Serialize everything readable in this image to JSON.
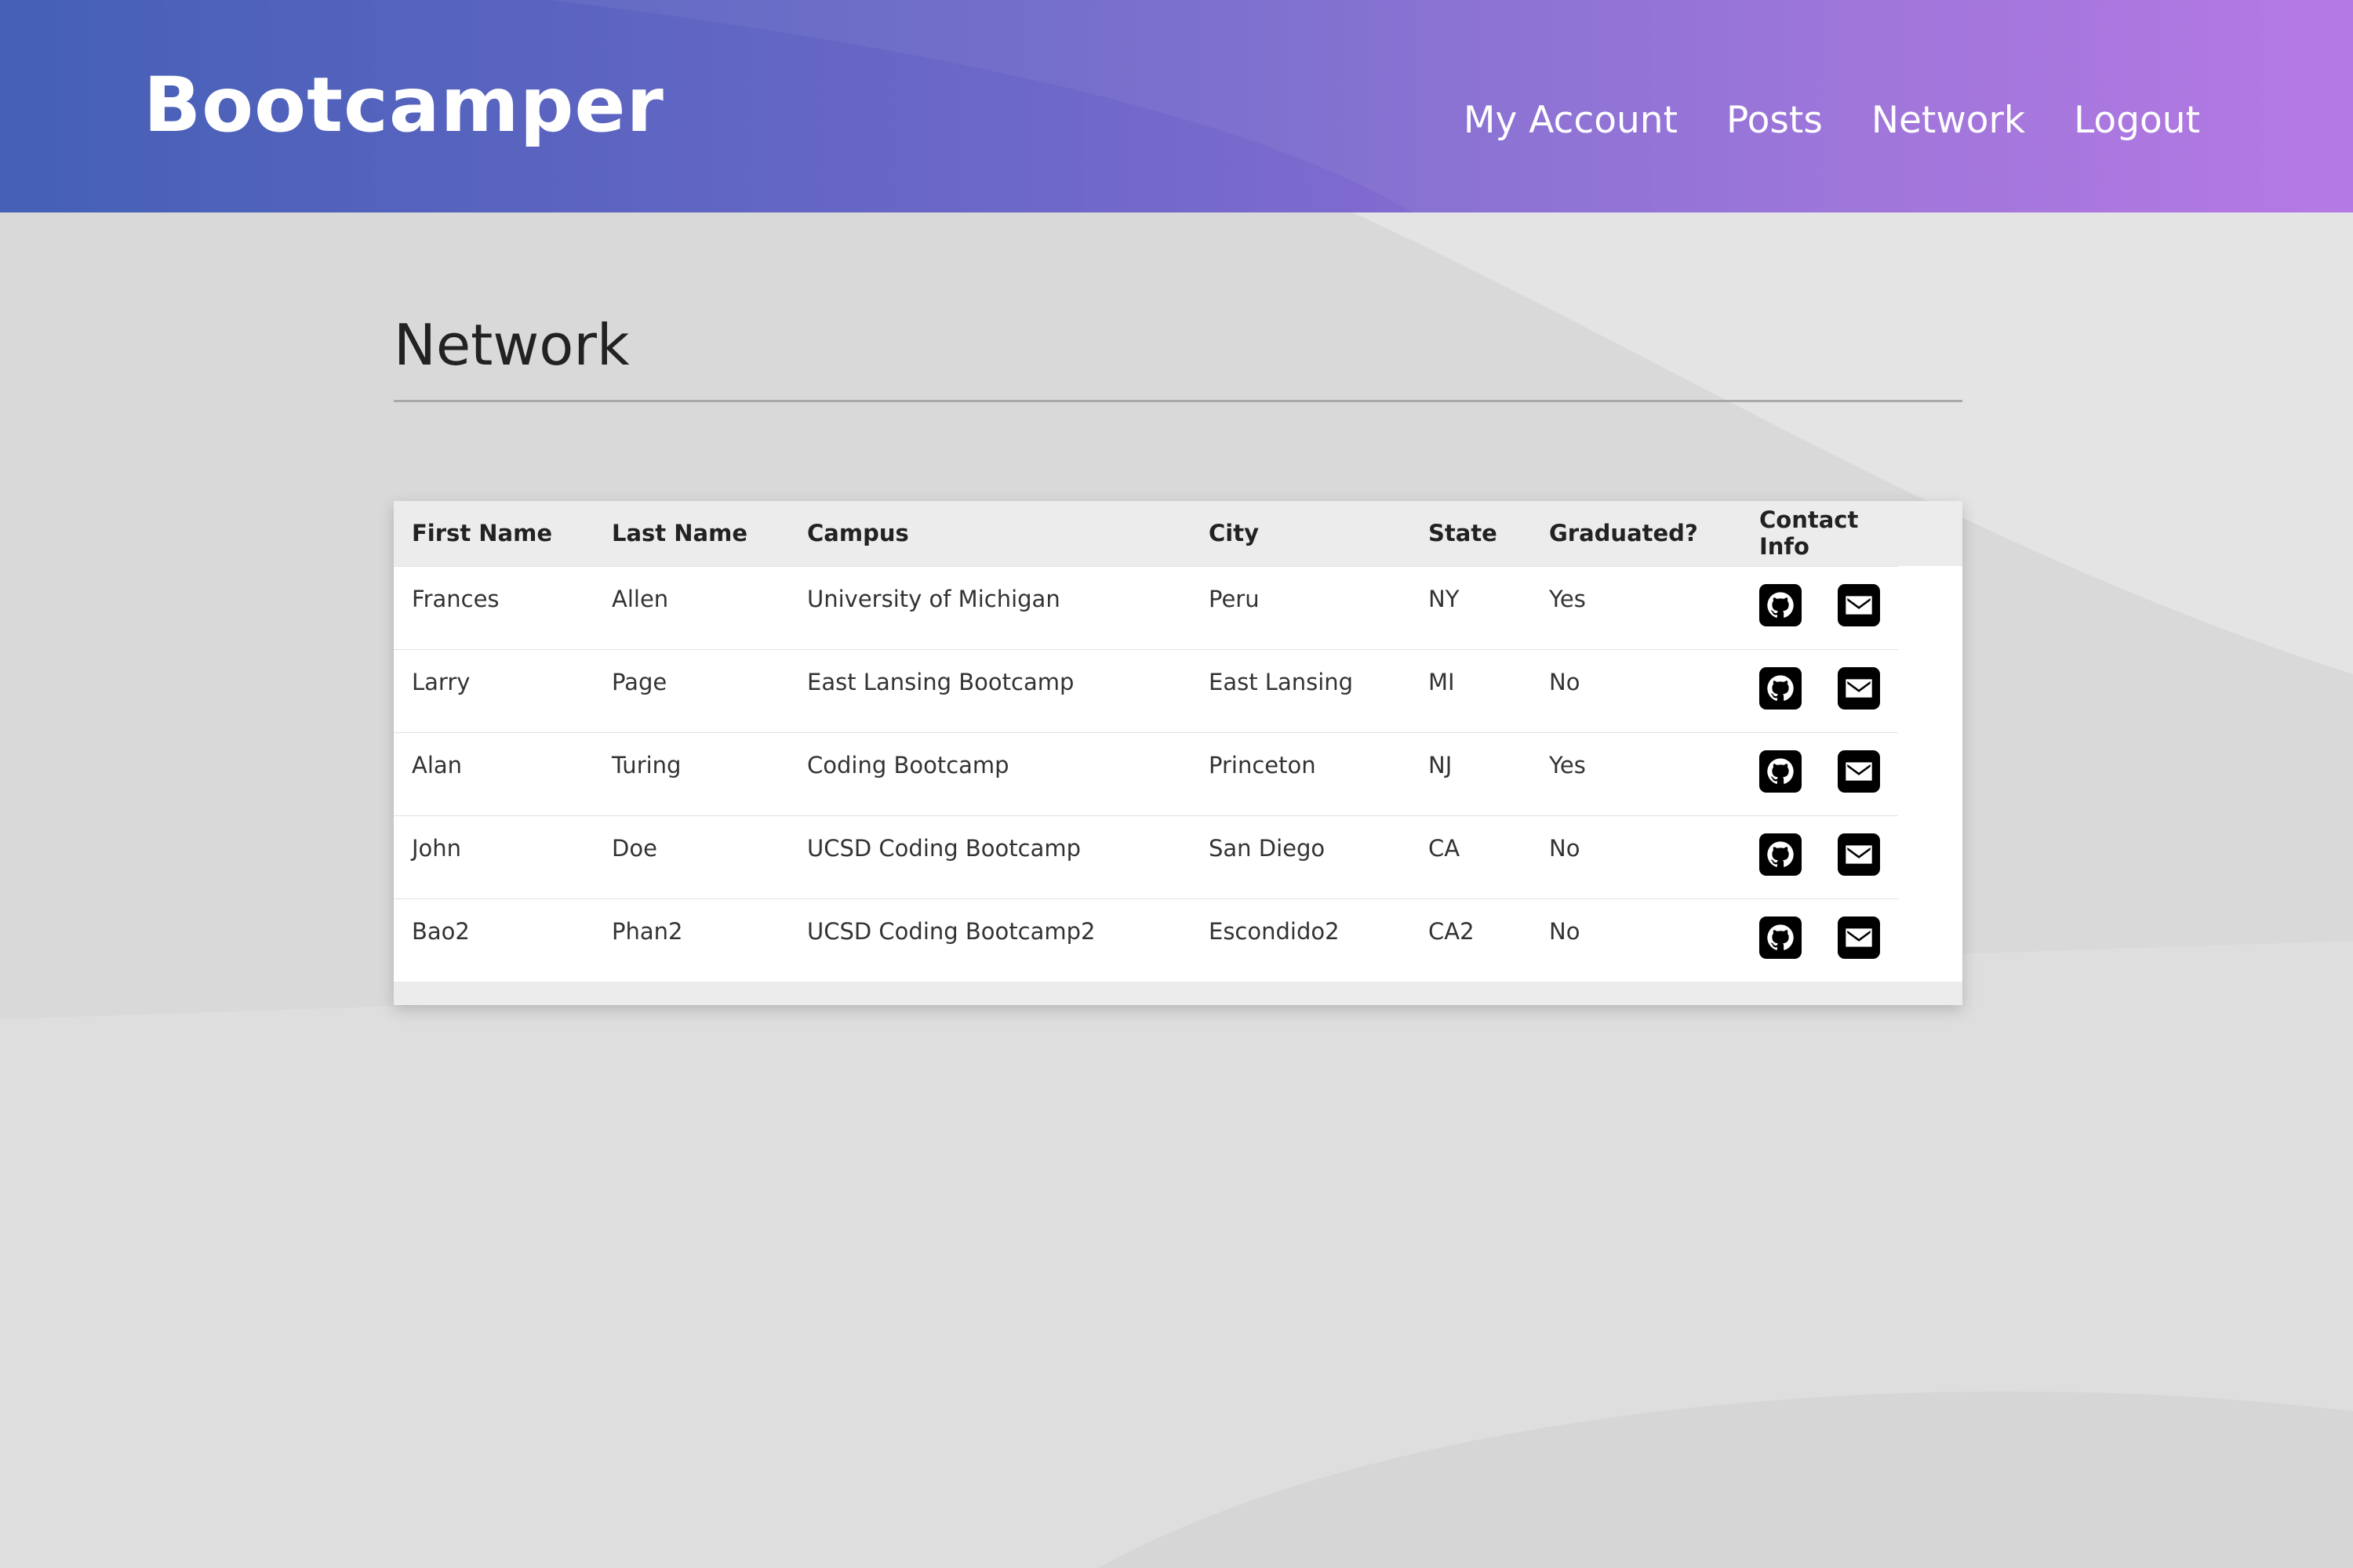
{
  "header": {
    "brand": "Bootcamper",
    "nav": [
      "My Account",
      "Posts",
      "Network",
      "Logout"
    ]
  },
  "page": {
    "title": "Network"
  },
  "table": {
    "columns": [
      "First Name",
      "Last Name",
      "Campus",
      "City",
      "State",
      "Graduated?",
      "Contact Info"
    ],
    "rows": [
      [
        "Frances",
        "Allen",
        "University of Michigan",
        "Peru",
        "NY",
        "Yes"
      ],
      [
        "Larry",
        "Page",
        "East Lansing Bootcamp",
        "East Lansing",
        "MI",
        "No"
      ],
      [
        "Alan",
        "Turing",
        "Coding Bootcamp",
        "Princeton",
        "NJ",
        "Yes"
      ],
      [
        "John",
        "Doe",
        "UCSD Coding Bootcamp",
        "San Diego",
        "CA",
        "No"
      ],
      [
        "Bao2",
        "Phan2",
        "UCSD Coding Bootcamp2",
        "Escondido2",
        "CA2",
        "No"
      ]
    ],
    "contact_icons": [
      "github-icon",
      "envelope-icon"
    ]
  },
  "colors": {
    "header_gradient_start": "#4560b6",
    "header_gradient_end": "#b272e4",
    "background": "#dcdcdc"
  }
}
